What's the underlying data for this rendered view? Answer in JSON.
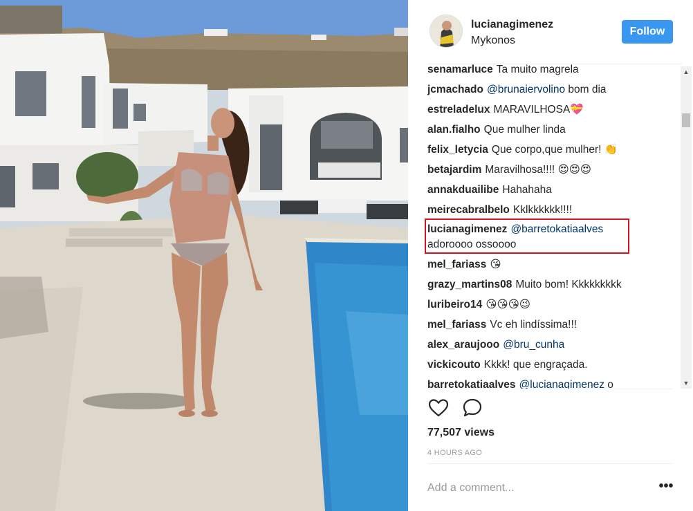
{
  "post": {
    "username": "lucianagimenez",
    "location": "Mykonos",
    "follow_label": "Follow"
  },
  "comments": [
    {
      "user": "senamarluce",
      "mention": "",
      "text": "Ta muito magrela"
    },
    {
      "user": "jcmachado",
      "mention": "@brunaiervolino",
      "text": " bom dia"
    },
    {
      "user": "estreladelux",
      "mention": "",
      "text": "MARAVILHOSA💝"
    },
    {
      "user": "alan.fialho",
      "mention": "",
      "text": "Que mulher linda"
    },
    {
      "user": "felix_letycia",
      "mention": "",
      "text": "Que corpo,que mulher! 👏"
    },
    {
      "user": "betajardim",
      "mention": "",
      "text": "Maravilhosa!!!! 😍😍😍"
    },
    {
      "user": "annakduailibe",
      "mention": "",
      "text": "Hahahaha"
    },
    {
      "user": "meirecabralbelo",
      "mention": "",
      "text": "Kklkkkkkk!!!!"
    },
    {
      "user": "lucianagimenez",
      "mention": "@barretokatiaalves",
      "text": "adoroooo ossoooo"
    },
    {
      "user": "mel_fariass",
      "mention": "",
      "text": "😘"
    },
    {
      "user": "grazy_martins08",
      "mention": "",
      "text": "Muito bom! Kkkkkkkkk"
    },
    {
      "user": "luribeiro14",
      "mention": "",
      "text": "😘😘😘😉"
    },
    {
      "user": "mel_fariass",
      "mention": "",
      "text": "Vc eh lindíssima!!!"
    },
    {
      "user": "alex_araujooo",
      "mention": "@bru_cunha",
      "text": ""
    },
    {
      "user": "vickicouto",
      "mention": "",
      "text": "Kkkk! que engraçada."
    },
    {
      "user": "barretokatiaalves",
      "mention": "@lucianagimenez",
      "text": " o"
    }
  ],
  "actions": {
    "like_icon": "heart-outline-icon",
    "comment_icon": "speech-bubble-icon"
  },
  "stats": {
    "views": "77,507 views",
    "time_ago": "4 HOURS AGO"
  },
  "add_comment": {
    "placeholder": "Add a comment...",
    "more_label": "•••"
  },
  "colors": {
    "follow_bg": "#3897f0",
    "mention": "#003569",
    "highlight_border": "#d5121e"
  }
}
